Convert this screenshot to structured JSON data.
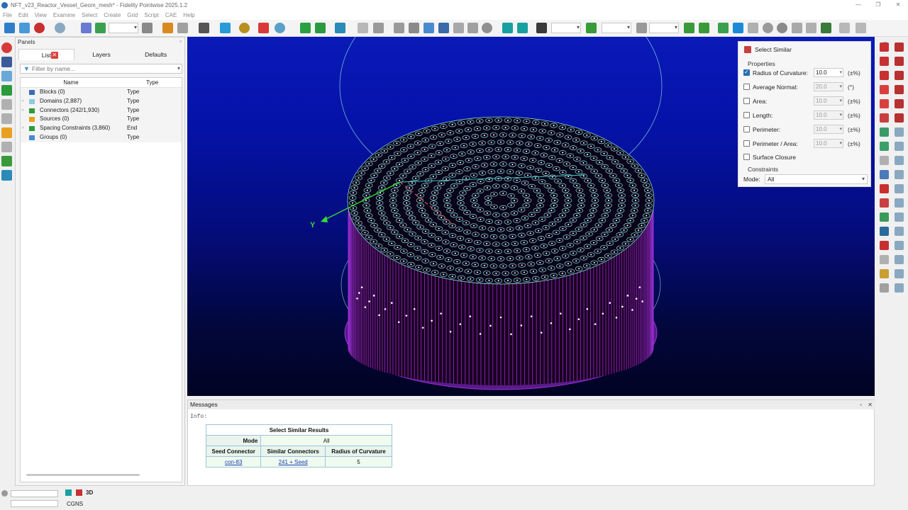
{
  "window": {
    "title": "NFT_v23_Reactor_Vessel_Geom_mesh* - Fidelity Pointwise 2025.1.2",
    "controls": [
      "—",
      "❐",
      "✕"
    ]
  },
  "menu": [
    "File",
    "Edit",
    "View",
    "Examine",
    "Select",
    "Create",
    "Grid",
    "Script",
    "CAE",
    "Help"
  ],
  "panels": {
    "title": "Panels",
    "tabs": [
      "List",
      "Layers",
      "Defaults"
    ],
    "active_tab": "List",
    "filter_placeholder": "Filter by name...",
    "columns": [
      "Name",
      "Type"
    ],
    "rows": [
      {
        "label": "Blocks (0)",
        "type": "Type",
        "expandable": false,
        "icon": "block-icon",
        "color": "#3a6db5"
      },
      {
        "label": "Domains (2,887)",
        "type": "Type",
        "expandable": true,
        "icon": "domain-icon",
        "color": "#8fc8e8"
      },
      {
        "label": "Connectors (242/1,930)",
        "type": "Type",
        "expandable": true,
        "icon": "connector-icon",
        "color": "#2e9a3e"
      },
      {
        "label": "Sources (0)",
        "type": "Type",
        "expandable": false,
        "icon": "source-icon",
        "color": "#e8a020"
      },
      {
        "label": "Spacing Constraints (3,860)",
        "type": "End",
        "expandable": true,
        "icon": "spacing-constraint-icon",
        "color": "#2e9a3e"
      },
      {
        "label": "Groups (0)",
        "type": "Type",
        "expandable": false,
        "icon": "group-icon",
        "color": "#4a8ad0"
      }
    ]
  },
  "viewport": {
    "axis_label": "Y",
    "colors": {
      "mesh": "#9b30d8",
      "rings": "#8fe0e0",
      "axis": "#33dd33"
    }
  },
  "select_similar": {
    "title": "Select Similar",
    "properties_label": "Properties",
    "properties": [
      {
        "label": "Radius of Curvature:",
        "value": "10.0",
        "unit": "(±%)",
        "checked": true
      },
      {
        "label": "Average Normal:",
        "value": "20.0",
        "unit": "(°)",
        "checked": false
      },
      {
        "label": "Area:",
        "value": "10.0",
        "unit": "(±%)",
        "checked": false
      },
      {
        "label": "Length:",
        "value": "10.0",
        "unit": "(±%)",
        "checked": false
      },
      {
        "label": "Perimeter:",
        "value": "10.0",
        "unit": "(±%)",
        "checked": false
      },
      {
        "label": "Perimeter / Area:",
        "value": "10.0",
        "unit": "(±%)",
        "checked": false
      }
    ],
    "surface_closure": {
      "label": "Surface Closure",
      "checked": false
    },
    "constraints_label": "Constraints",
    "mode_label": "Mode:",
    "mode_value": "All"
  },
  "messages": {
    "title": "Messages",
    "info": "Info:",
    "results": {
      "caption": "Select Similar Results",
      "mode_label": "Mode",
      "mode_value": "All",
      "headers": [
        "Seed Connector",
        "Similar Connectors",
        "Radius of Curvature"
      ],
      "row": {
        "seed": "con-83",
        "similar": "241 + Seed",
        "radius": "5"
      }
    }
  },
  "status": {
    "view_mode": "3D",
    "solver": "CGNS"
  }
}
